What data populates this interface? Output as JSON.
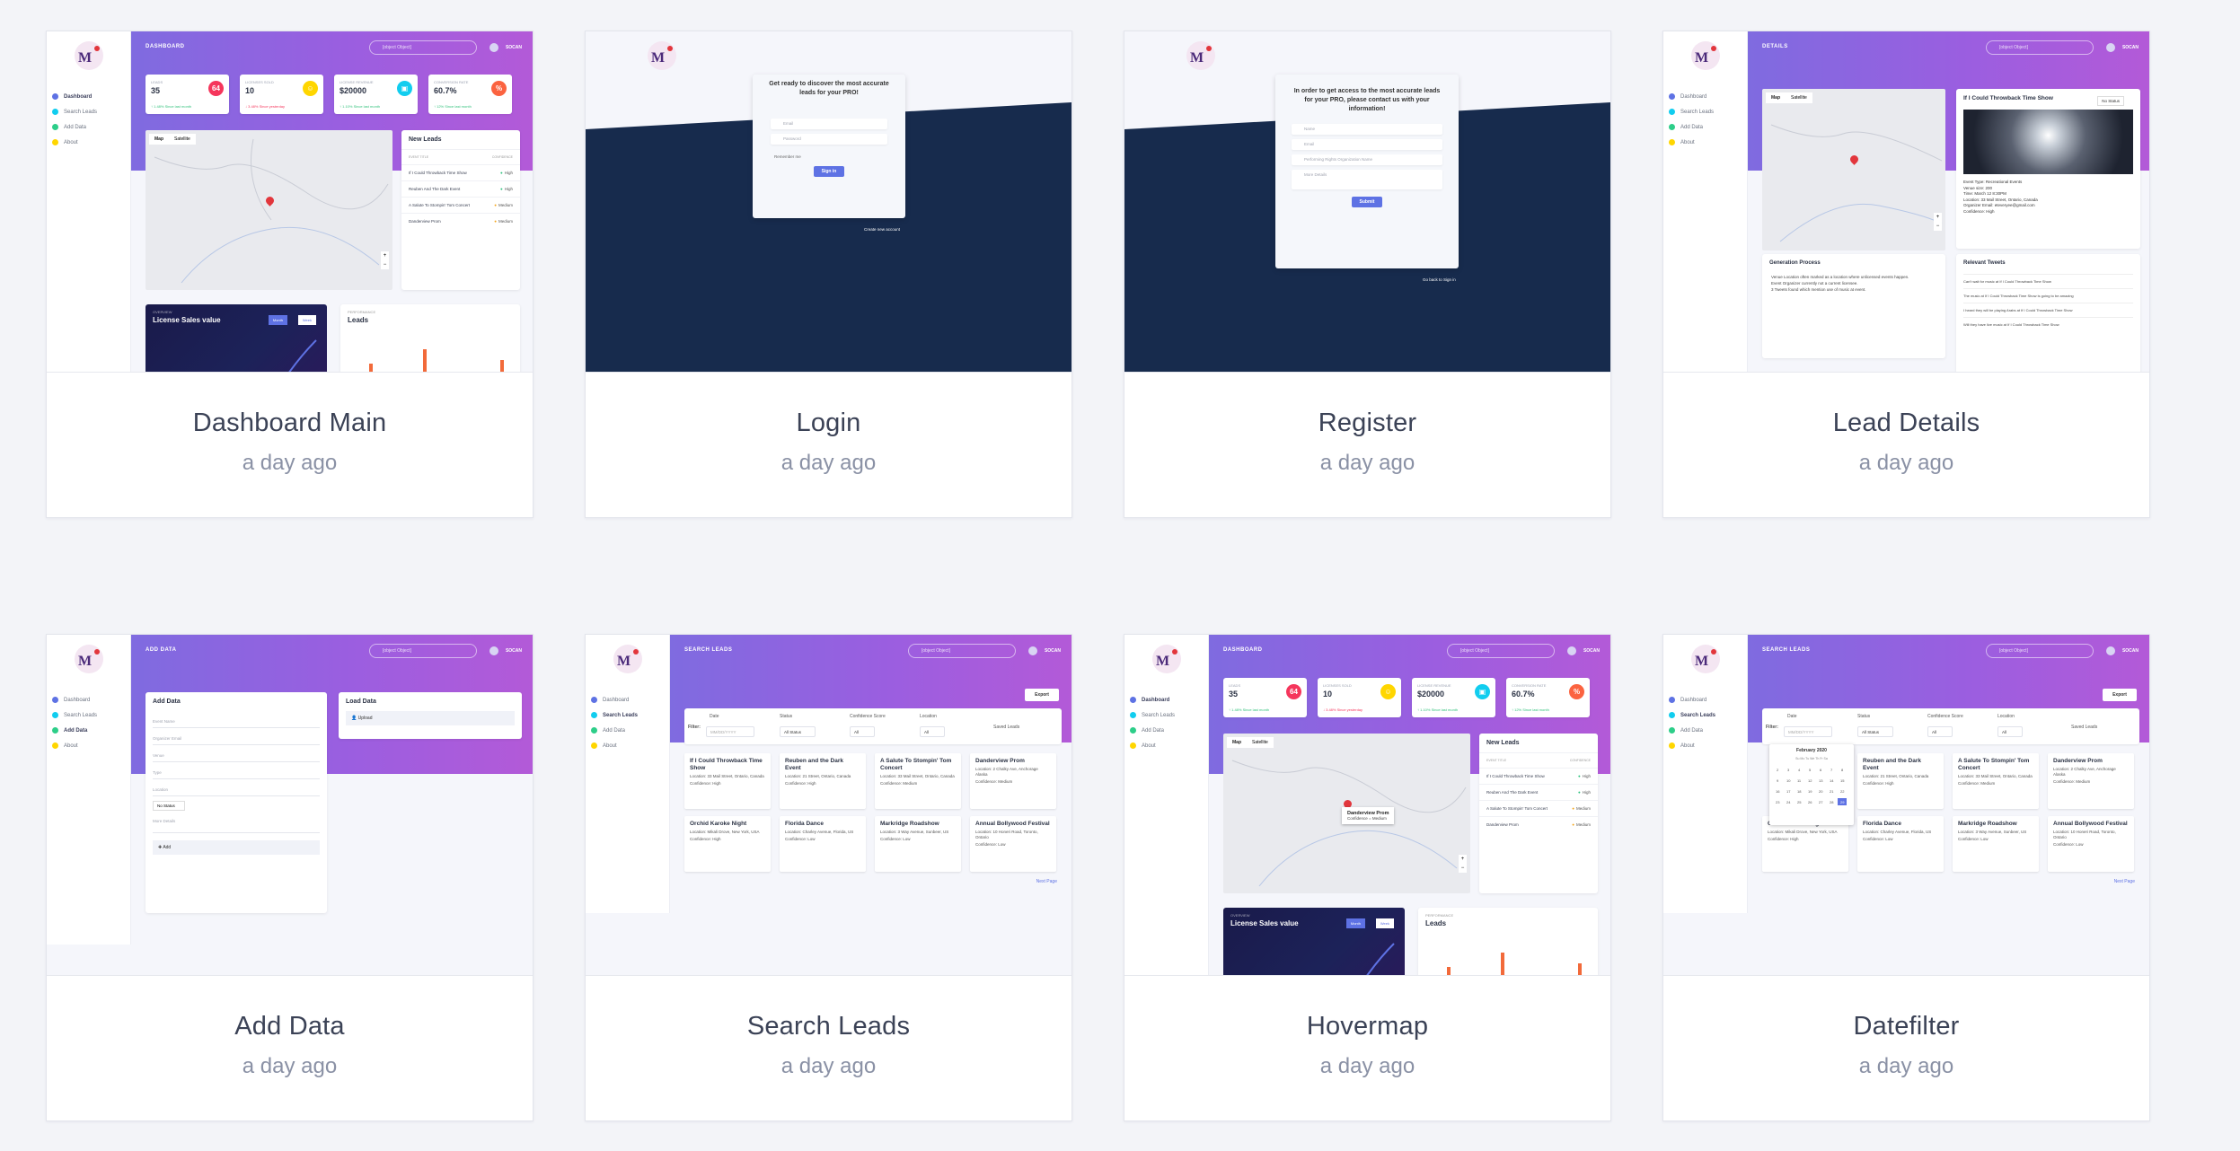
{
  "cards": [
    {
      "title": "Dashboard Main",
      "time": "a day ago"
    },
    {
      "title": "Login",
      "time": "a day ago"
    },
    {
      "title": "Register",
      "time": "a day ago"
    },
    {
      "title": "Lead Details",
      "time": "a day ago"
    },
    {
      "title": "Add Data",
      "time": "a day ago"
    },
    {
      "title": "Search Leads",
      "time": "a day ago"
    },
    {
      "title": "Hovermap",
      "time": "a day ago"
    },
    {
      "title": "Datefilter",
      "time": "a day ago"
    }
  ],
  "thumb": {
    "nav": [
      "Dashboard",
      "Search Leads",
      "Add Data",
      "About"
    ],
    "search": {
      "filter": "Filter:",
      "date": "Date",
      "status": "Status",
      "confidence": "Confidence Score",
      "location": "Location",
      "saved": "Saved Leads",
      "all_status": "All Status",
      "all": "All",
      "date_ph": "MM/DD/YYYY",
      "export": "Export",
      "next": "Next Page",
      "leads": [
        {
          "title": "If I Could Throwback Time Show",
          "loc": "Location: 33 Mail Street, Ontario, Canada",
          "conf": "Confidence: High"
        },
        {
          "title": "Reuben and the Dark Event",
          "loc": "Location: 21 Street, Ontario, Canada",
          "conf": "Confidence: High"
        },
        {
          "title": "A Salute To Stompin' Tom Concert",
          "loc": "Location: 33 Mail Street, Ontario, Canada",
          "conf": "Confidence: Medium"
        },
        {
          "title": "Danderview Prom",
          "loc": "Location: 2 Chalky Ave, Anchorage Alaska",
          "conf": "Confidence: Medium"
        },
        {
          "title": "Orchid Karoke Night",
          "loc": "Location: Mikali Drove, New York, USA",
          "conf": "Confidence: High"
        },
        {
          "title": "Florida Dance",
          "loc": "Location: Charley Avenue, Florida, US",
          "conf": "Confidence: Low"
        },
        {
          "title": "Markridge Roadshow",
          "loc": "Location: 3 Way Avenue, Sunbeer, US",
          "conf": "Confidence: Low"
        },
        {
          "title": "Annual Bollywood Festival",
          "loc": "Location: 10 Honeri Road, Toronto, Ontario",
          "conf": "Confidence: Low"
        }
      ]
    },
    "user": "SOCAN",
    "dashboard_title": "DASHBOARD",
    "details_title": "DETAILS",
    "add_title": "ADD DATA",
    "search_title": "SEARCH LEADS",
    "stats": [
      {
        "label": "LEADS",
        "value": "35",
        "sub": "↑ 1.48%  Since last month",
        "color": "#f5365c",
        "icon": "64"
      },
      {
        "label": "LICENSES SOLD",
        "value": "10",
        "sub": "↓ 3.48%  Since yesterday",
        "color": "#ffd600",
        "icon": "☺"
      },
      {
        "label": "LICENSE REVENUE",
        "value": "$20000",
        "sub": "↑ 1.10%  Since last month",
        "color": "#11cdef",
        "icon": "▣"
      },
      {
        "label": "CONVERSION RATE",
        "value": "60.7%",
        "sub": "↑ 12%  Since last month",
        "color": "#fb6340",
        "icon": "%"
      }
    ],
    "map_tabs": [
      "Map",
      "Satellite"
    ],
    "new_leads": {
      "title": "New Leads",
      "col1": "EVENT TITLE",
      "col2": "CONFIDENCE",
      "rows": [
        {
          "event": "If I Could Throwback Time Show",
          "conf": "High"
        },
        {
          "event": "Reuben And The Dark Event",
          "conf": "High"
        },
        {
          "event": "A Salute To Stompin' Tom Concert",
          "conf": "Medium"
        },
        {
          "event": "Danderview Prom",
          "conf": "Medium"
        }
      ]
    },
    "sales": {
      "overline": "OVERVIEW",
      "title": "License Sales value",
      "btn1": "Month",
      "btn2": "Week"
    },
    "leads_chart": {
      "overline": "PERFORMANCE",
      "title": "Leads"
    },
    "login": {
      "heading": "Get ready to discover the most accurate leads for your PRO!",
      "email": "Email",
      "password": "Password",
      "remember": "Remember me",
      "button": "Sign in",
      "create": "Create new account"
    },
    "register": {
      "heading": "In order to get access to the most accurate leads for your PRO, please contact us with your information!",
      "fields": [
        "Name",
        "Email",
        "Performing Rights Organization Name",
        "More Details"
      ],
      "button": "Submit",
      "back": "Go back to Sign in"
    },
    "details": {
      "event": "If I Could Throwback Time Show",
      "status": "No Status",
      "lines": [
        "Event Type: Recreational Events",
        "Venue size: 200",
        "Time: March 12 8:30PM",
        "Location: 33 Mail Street, Ontario, Canada",
        "Organizer Email: eteveryee@gmail.com",
        "Confidence: High"
      ],
      "gen_title": "Generation Process",
      "gen_items": [
        "Venue Location often marked as a location where unlicensed events happen.",
        "Event Organizer currently not a current licensee.",
        "3 Tweets found which mention use of music at event."
      ],
      "tweets_title": "Relevant Tweets",
      "tweets": [
        "Can't wait for music at If I Could Throwback Time Show",
        "The music at If I Could Throwback Time Show is going to be amazing",
        "I heard they will be playing Arabs at If I Could Throwback Time Show",
        "Will they have live music at If I Could Throwback Time Show"
      ]
    },
    "add": {
      "panel_title": "Add Data",
      "fields": [
        "Event Name",
        "Organizer Email",
        "Venue",
        "Type",
        "Location"
      ],
      "status": "No Status",
      "more": "More Details",
      "add_btn": "Add",
      "load_title": "Load Data",
      "upload": "Upload"
    },
    "hover": {
      "title": "Danderview Prom",
      "sub": "Confidence = Medium"
    },
    "calendar": {
      "month": "February 2020",
      "days": "Su Mo Tu We Th Fr Sa"
    }
  }
}
